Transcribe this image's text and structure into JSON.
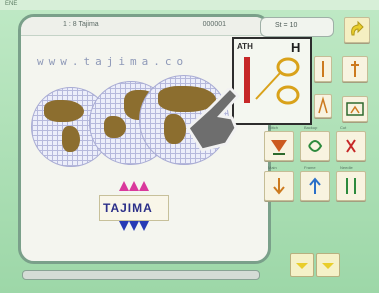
{
  "top_strip": {
    "text": "ENE"
  },
  "panel": {
    "head_left": "1 : 8 Tajima",
    "head_right": "000001"
  },
  "url_text": "www.tajima.co",
  "logo": {
    "text": "TAJIMA"
  },
  "counter": {
    "text": "St = 10"
  },
  "zoom": {
    "ath_label": "ATH",
    "corner_letter": "H"
  },
  "buttons_row1_labels": [
    "Stitch",
    "Backup",
    "Cut"
  ],
  "buttons_row2_labels": [
    "Main",
    "Frame",
    "Needle"
  ],
  "colors": {
    "accent": "#e9ce2b",
    "frame": "#7aa08a",
    "globe_land": "#8c6e2f",
    "logo_up": "#d9389c",
    "logo_down": "#273bb5"
  }
}
